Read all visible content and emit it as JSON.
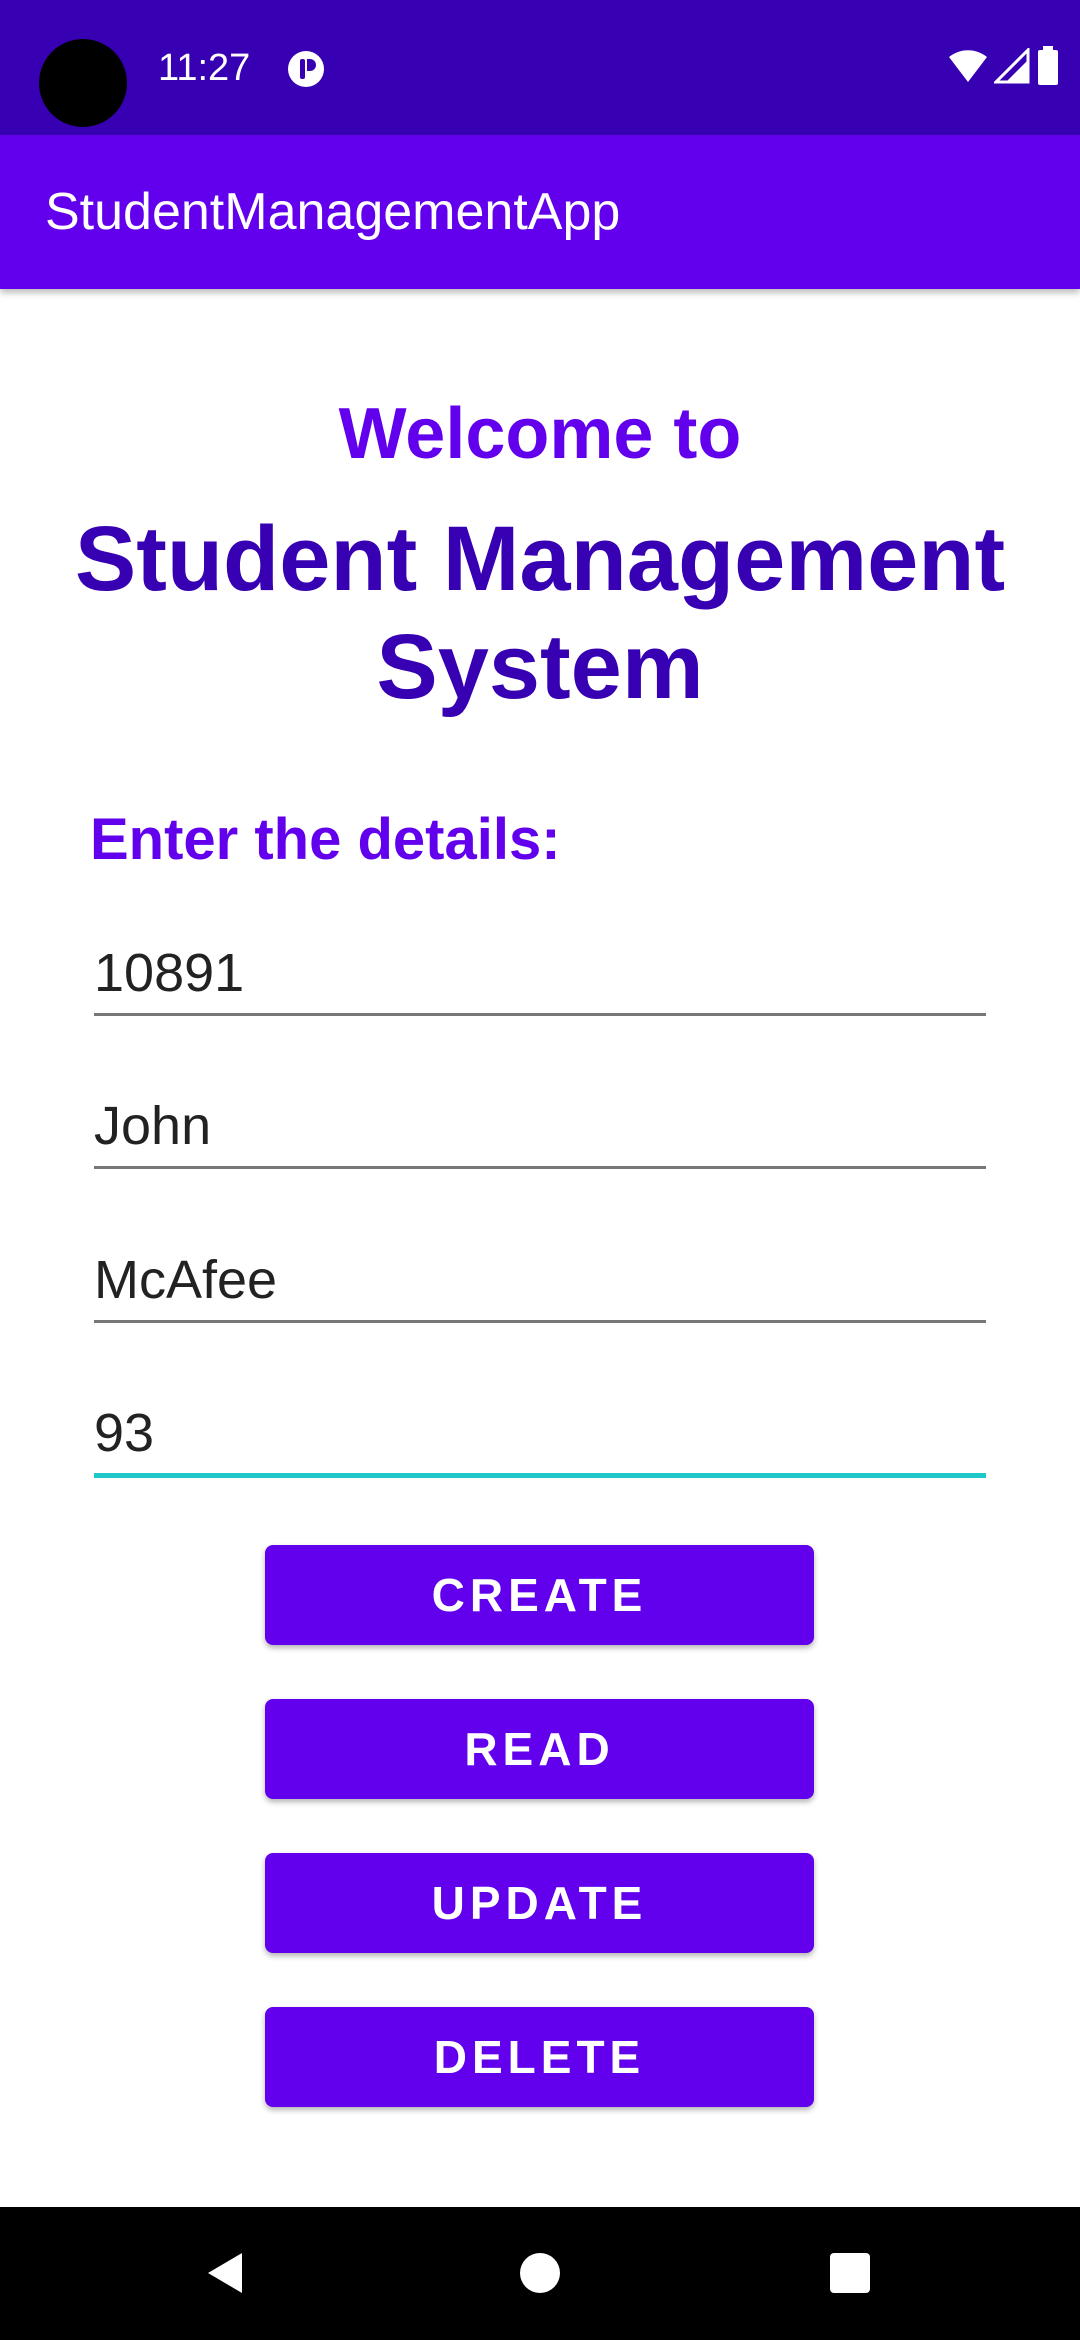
{
  "status_bar": {
    "time": "11:27",
    "icons": [
      "camera-cutout",
      "app-notification-icon",
      "wifi-icon",
      "signal-icon",
      "battery-icon"
    ]
  },
  "app_bar": {
    "title": "StudentManagementApp"
  },
  "main": {
    "welcome": "Welcome to",
    "system_title": "Student Management System",
    "details_label": "Enter the details:"
  },
  "form": {
    "student_id": "10891",
    "first_name": "John",
    "last_name": "McAfee",
    "marks": "93"
  },
  "buttons": {
    "create": "CREATE",
    "read": "READ",
    "update": "UPDATE",
    "delete": "DELETE"
  },
  "nav_bar": {
    "icons": [
      "back-icon",
      "home-icon",
      "recents-icon"
    ]
  },
  "colors": {
    "status_bar": "#3700b3",
    "primary": "#6200ee",
    "title_dark": "#3700b3",
    "focus_accent": "#1ec8c8"
  }
}
